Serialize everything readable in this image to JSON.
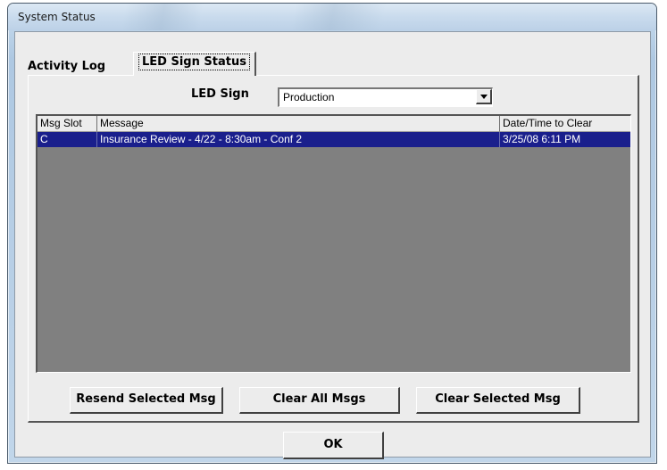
{
  "window": {
    "title": "System Status"
  },
  "tabs": [
    {
      "label": "Activity Log",
      "selected": false
    },
    {
      "label": "LED Sign Status",
      "selected": true
    }
  ],
  "led_sign": {
    "label": "LED Sign",
    "selected_value": "Production"
  },
  "list": {
    "columns": [
      "Msg Slot",
      "Message",
      "Date/Time to Clear"
    ],
    "rows": [
      {
        "slot": "C",
        "message": "Insurance Review - 4/22 - 8:30am - Conf 2",
        "date_time": "3/25/08 6:11 PM",
        "selected": true
      }
    ]
  },
  "buttons": {
    "resend": "Resend Selected Msg",
    "clear_all": "Clear All Msgs",
    "clear_selected": "Clear Selected Msg",
    "ok": "OK"
  },
  "colors": {
    "selection": "#1a1f8c",
    "list_background": "#808080",
    "dialog_face": "#ececec"
  }
}
